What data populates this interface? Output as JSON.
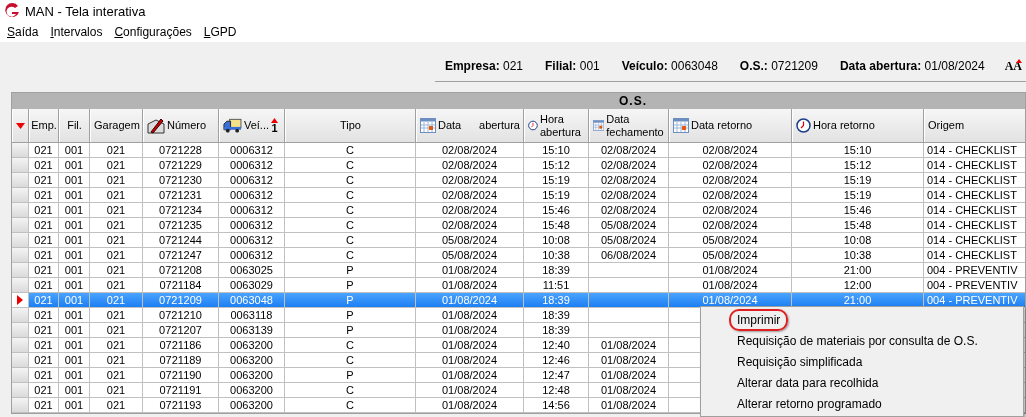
{
  "window": {
    "title": "MAN - Tela interativa"
  },
  "menu": [
    {
      "label": "Saída"
    },
    {
      "label": "Intervalos"
    },
    {
      "label": "Configurações"
    },
    {
      "label": "LGPD"
    }
  ],
  "info": [
    {
      "label": "Empresa:",
      "value": "021"
    },
    {
      "label": "Filial:",
      "value": "001"
    },
    {
      "label": "Veículo:",
      "value": "0063048"
    },
    {
      "label": "O.S.:",
      "value": "0721209"
    },
    {
      "label": "Data abertura:",
      "value": "01/08/2024"
    }
  ],
  "font_button": "AA",
  "table": {
    "group_header": "O.S.",
    "columns": [
      {
        "kind": "plain",
        "label": "Emp."
      },
      {
        "kind": "plain",
        "label": "Fil."
      },
      {
        "kind": "plain",
        "label": "Garagem"
      },
      {
        "kind": "edit",
        "label": "Número"
      },
      {
        "kind": "vehicle",
        "label": "Veí...",
        "sort": "1"
      },
      {
        "kind": "plain",
        "label": "Tipo"
      },
      {
        "kind": "calendar",
        "label": "Data",
        "label_right": "abertura"
      },
      {
        "kind": "clock",
        "label": "Hora abertura"
      },
      {
        "kind": "calendar",
        "label": "Data fechamento"
      },
      {
        "kind": "calendar",
        "label": "Data retorno"
      },
      {
        "kind": "clock",
        "label": "Hora retorno"
      },
      {
        "kind": "plain",
        "label": "Origem"
      }
    ],
    "rows": [
      {
        "selected": false,
        "cells": [
          "021",
          "001",
          "021",
          "0721228",
          "0006312",
          "C",
          "02/08/2024",
          "15:10",
          "02/08/2024",
          "02/08/2024",
          "15:10",
          "014 - CHECKLIST"
        ]
      },
      {
        "selected": false,
        "cells": [
          "021",
          "001",
          "021",
          "0721229",
          "0006312",
          "C",
          "02/08/2024",
          "15:12",
          "02/08/2024",
          "02/08/2024",
          "15:12",
          "014 - CHECKLIST"
        ]
      },
      {
        "selected": false,
        "cells": [
          "021",
          "001",
          "021",
          "0721230",
          "0006312",
          "C",
          "02/08/2024",
          "15:19",
          "02/08/2024",
          "02/08/2024",
          "15:19",
          "014 - CHECKLIST"
        ]
      },
      {
        "selected": false,
        "cells": [
          "021",
          "001",
          "021",
          "0721231",
          "0006312",
          "C",
          "02/08/2024",
          "15:19",
          "02/08/2024",
          "02/08/2024",
          "15:19",
          "014 - CHECKLIST"
        ]
      },
      {
        "selected": false,
        "cells": [
          "021",
          "001",
          "021",
          "0721234",
          "0006312",
          "C",
          "02/08/2024",
          "15:46",
          "02/08/2024",
          "02/08/2024",
          "15:46",
          "014 - CHECKLIST"
        ]
      },
      {
        "selected": false,
        "cells": [
          "021",
          "001",
          "021",
          "0721235",
          "0006312",
          "C",
          "02/08/2024",
          "15:48",
          "05/08/2024",
          "02/08/2024",
          "15:48",
          "014 - CHECKLIST"
        ]
      },
      {
        "selected": false,
        "cells": [
          "021",
          "001",
          "021",
          "0721244",
          "0006312",
          "C",
          "05/08/2024",
          "10:08",
          "05/08/2024",
          "05/08/2024",
          "10:08",
          "014 - CHECKLIST"
        ]
      },
      {
        "selected": false,
        "cells": [
          "021",
          "001",
          "021",
          "0721247",
          "0006312",
          "C",
          "05/08/2024",
          "10:38",
          "06/08/2024",
          "05/08/2024",
          "10:38",
          "014 - CHECKLIST"
        ]
      },
      {
        "selected": false,
        "cells": [
          "021",
          "001",
          "021",
          "0721208",
          "0063025",
          "P",
          "01/08/2024",
          "18:39",
          "",
          "01/08/2024",
          "21:00",
          "004 - PREVENTIV"
        ]
      },
      {
        "selected": false,
        "cells": [
          "021",
          "001",
          "021",
          "0721184",
          "0063029",
          "P",
          "01/08/2024",
          "11:51",
          "",
          "01/08/2024",
          "12:00",
          "004 - PREVENTIV"
        ]
      },
      {
        "selected": true,
        "cells": [
          "021",
          "001",
          "021",
          "0721209",
          "0063048",
          "P",
          "01/08/2024",
          "18:39",
          "",
          "01/08/2024",
          "21:00",
          "004 - PREVENTIV"
        ]
      },
      {
        "selected": false,
        "cells": [
          "021",
          "001",
          "021",
          "0721210",
          "0063118",
          "P",
          "01/08/2024",
          "18:39",
          ""
        ]
      },
      {
        "selected": false,
        "cells": [
          "021",
          "001",
          "021",
          "0721207",
          "0063139",
          "P",
          "01/08/2024",
          "18:39",
          ""
        ]
      },
      {
        "selected": false,
        "cells": [
          "021",
          "001",
          "021",
          "0721186",
          "0063200",
          "C",
          "01/08/2024",
          "12:40",
          "01/08/2024"
        ]
      },
      {
        "selected": false,
        "cells": [
          "021",
          "001",
          "021",
          "0721189",
          "0063200",
          "C",
          "01/08/2024",
          "12:46",
          "01/08/2024"
        ]
      },
      {
        "selected": false,
        "cells": [
          "021",
          "001",
          "021",
          "0721190",
          "0063200",
          "P",
          "01/08/2024",
          "12:47",
          "01/08/2024"
        ]
      },
      {
        "selected": false,
        "cells": [
          "021",
          "001",
          "021",
          "0721191",
          "0063200",
          "C",
          "01/08/2024",
          "12:48",
          "01/08/2024"
        ]
      },
      {
        "selected": false,
        "cells": [
          "021",
          "001",
          "021",
          "0721193",
          "0063200",
          "C",
          "01/08/2024",
          "14:56",
          "01/08/2024"
        ]
      }
    ]
  },
  "context_menu": [
    {
      "label": "Imprimir",
      "highlighted": true
    },
    {
      "label": "Requisição de materiais por consulta de O.S.",
      "highlighted": false
    },
    {
      "label": "Requisição simplificada",
      "highlighted": false
    },
    {
      "label": "Alterar data para recolhida",
      "highlighted": false
    },
    {
      "label": "Alterar retorno programado",
      "highlighted": false
    }
  ]
}
